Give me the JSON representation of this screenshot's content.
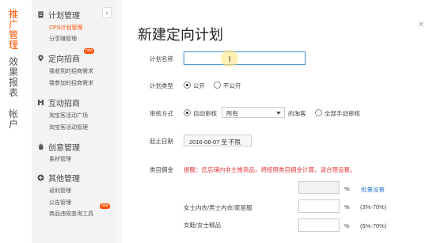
{
  "vnav": {
    "items": [
      {
        "label": "推广管理"
      },
      {
        "label": "效果报表"
      },
      {
        "label": "帐户"
      }
    ]
  },
  "sidebar": {
    "collapse_glyph": "‹",
    "new_badge": "new",
    "groups": [
      {
        "label": "计划管理",
        "icon": "document-icon",
        "items": [
          {
            "label": "CPS计划管理"
          },
          {
            "label": "分享赚管理"
          }
        ]
      },
      {
        "label": "定向招商",
        "icon": "location-pin-icon",
        "items": [
          {
            "label": "我收到的招商需求"
          },
          {
            "label": "我参加的招商需求"
          }
        ]
      },
      {
        "label": "互动招商",
        "icon": "handshake-icon",
        "items": [
          {
            "label": "淘宝客活动广场"
          },
          {
            "label": "淘宝客活动管理"
          }
        ]
      },
      {
        "label": "创意管理",
        "icon": "hand-icon",
        "items": [
          {
            "label": "素材管理"
          }
        ]
      },
      {
        "label": "其他管理",
        "icon": "plus-circle-icon",
        "items": [
          {
            "label": "返利管理"
          },
          {
            "label": "公告管理"
          },
          {
            "label": "商品违规查询工具"
          }
        ]
      }
    ]
  },
  "dialog": {
    "title": "新建定向计划",
    "close_glyph": "×",
    "fields": {
      "plan_name": {
        "label": "计划名称",
        "value": ""
      },
      "plan_type": {
        "label": "计划类型",
        "options": [
          "公开",
          "不公开"
        ],
        "selected": "公开"
      },
      "review": {
        "label": "审核方式",
        "auto": "自动审核",
        "select_value": "所有",
        "suffix": "的淘客",
        "manual": "全部手动审核"
      },
      "start_date": {
        "label": "起止日期",
        "value": "2016-08-07 至 不限"
      },
      "commission": {
        "label": "类目佣金",
        "warning": "提醒：您店铺内非主推商品，将按照类目佣金计算，请合理设置。",
        "batch_value": "",
        "percent": "%",
        "batch_link": "批量设置",
        "rows": [
          {
            "category": "女士内衣/男士内衣/家居服",
            "value": "",
            "range": "(3%-70%)"
          },
          {
            "category": "女鞋/女士精品",
            "value": "",
            "range": "(5%-70%)"
          }
        ]
      }
    }
  }
}
